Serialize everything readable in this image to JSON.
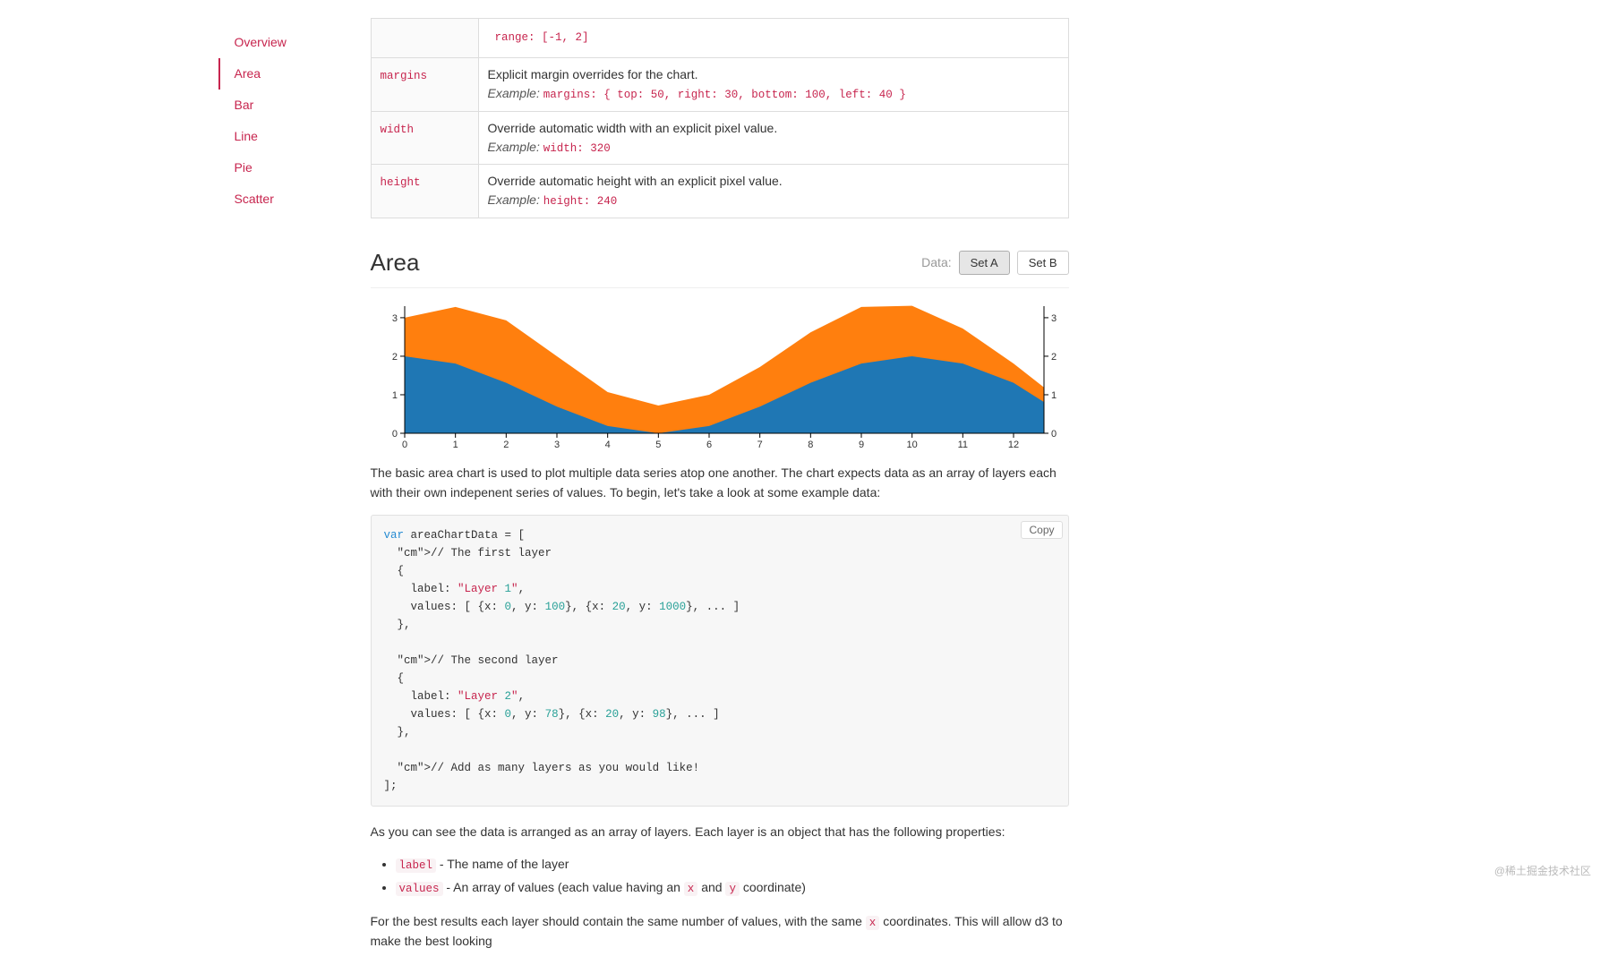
{
  "sidebar": {
    "items": [
      {
        "label": "Overview",
        "active": false
      },
      {
        "label": "Area",
        "active": true
      },
      {
        "label": "Bar",
        "active": false
      },
      {
        "label": "Line",
        "active": false
      },
      {
        "label": "Pie",
        "active": false
      },
      {
        "label": "Scatter",
        "active": false
      }
    ]
  },
  "options_table": {
    "truncated_example": "range: [-1, 2]",
    "rows": [
      {
        "key": "margins",
        "desc": "Explicit margin overrides for the chart.",
        "example_label": "Example:",
        "example_code": "margins: { top: 50, right: 30, bottom: 100, left: 40 }"
      },
      {
        "key": "width",
        "desc": "Override automatic width with an explicit pixel value.",
        "example_label": "Example:",
        "example_code": "width: 320"
      },
      {
        "key": "height",
        "desc": "Override automatic height with an explicit pixel value.",
        "example_label": "Example:",
        "example_code": "height: 240"
      }
    ]
  },
  "area": {
    "heading": "Area",
    "data_label": "Data:",
    "buttons": {
      "a": "Set A",
      "b": "Set B"
    },
    "intro": "The basic area chart is used to plot multiple data series atop one another. The chart expects data as an array of layers each with their own indepenent series of values. To begin, let's take a look at some example data:",
    "copy_label": "Copy",
    "code_lines": {
      "l0": "var areaChartData = [",
      "l1": "  // The first layer",
      "l2": "  {",
      "l3": "    label: \"Layer 1\",",
      "l4": "    values: [ {x: 0, y: 100}, {x: 20, y: 1000}, ... ]",
      "l5": "  },",
      "l6": "",
      "l7": "  // The second layer",
      "l8": "  {",
      "l9": "    label: \"Layer 2\",",
      "l10": "    values: [ {x: 0, y: 78}, {x: 20, y: 98}, ... ]",
      "l11": "  },",
      "l12": "",
      "l13": "  // Add as many layers as you would like!",
      "l14": "];"
    },
    "after_code": "As you can see the data is arranged as an array of layers. Each layer is an object that has the following properties:",
    "props": {
      "label_key": "label",
      "label_desc": " - The name of the layer",
      "values_key": "values",
      "values_desc_1": " - An array of values (each value having an ",
      "values_x": "x",
      "values_desc_2": " and ",
      "values_y": "y",
      "values_desc_3": " coordinate)"
    },
    "footer_1": "For the best results each layer should contain the same number of values, with the same ",
    "footer_x": "x",
    "footer_2": " coordinates. This will allow d3 to make the best looking"
  },
  "chart_data": {
    "type": "area",
    "title": "",
    "xlabel": "",
    "ylabel": "",
    "x": [
      0,
      1,
      2,
      3,
      4,
      5,
      6,
      7,
      8,
      9,
      10,
      11,
      12,
      12.6
    ],
    "x_ticks": [
      0,
      1,
      2,
      3,
      4,
      5,
      6,
      7,
      8,
      9,
      10,
      11,
      12
    ],
    "ylim": [
      0,
      3.3
    ],
    "y_ticks_left": [
      0,
      1,
      2,
      3
    ],
    "y_ticks_right": [
      0,
      1,
      2,
      3
    ],
    "series": [
      {
        "name": "Layer 1 (blue)",
        "color": "#1f77b4",
        "values": [
          2.0,
          1.81,
          1.31,
          0.69,
          0.19,
          0.0,
          0.19,
          0.69,
          1.31,
          1.81,
          2.0,
          1.81,
          1.31,
          0.81
        ]
      },
      {
        "name": "Layer 2 (orange)",
        "color": "#ff7f0e",
        "values": [
          3.0,
          3.28,
          2.93,
          2.0,
          1.07,
          0.72,
          1.0,
          1.72,
          2.62,
          3.28,
          3.31,
          2.72,
          1.81,
          1.19
        ]
      }
    ]
  },
  "watermark": "@稀土掘金技术社区"
}
